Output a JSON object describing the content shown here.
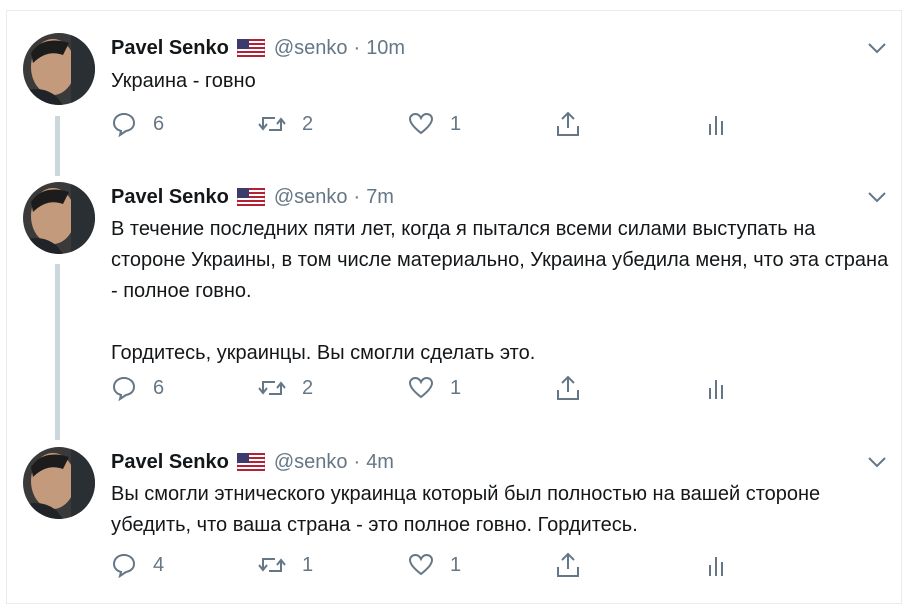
{
  "colors": {
    "text": "#14171a",
    "muted": "#657786",
    "thread_line": "#ccd6dd",
    "divider": "#e6ecf0"
  },
  "tweets": [
    {
      "author": "Pavel Senko",
      "flag_icon": "us-flag-icon",
      "handle": "@senko",
      "separator": "·",
      "time": "10m",
      "paragraphs": [
        "Украина - говно"
      ],
      "replies": "6",
      "retweets": "2",
      "likes": "1"
    },
    {
      "author": "Pavel Senko",
      "flag_icon": "us-flag-icon",
      "handle": "@senko",
      "separator": "·",
      "time": "7m",
      "paragraphs": [
        "В течение последних пяти лет, когда я пытался всеми силами выступать на стороне Украины, в том числе материально, Украина убедила меня, что эта страна - полное говно.",
        "Гордитесь, украинцы. Вы смогли сделать это."
      ],
      "replies": "6",
      "retweets": "2",
      "likes": "1"
    },
    {
      "author": "Pavel Senko",
      "flag_icon": "us-flag-icon",
      "handle": "@senko",
      "separator": "·",
      "time": "4m",
      "paragraphs": [
        "Вы смогли этнического украинца который был полностью на вашей стороне убедить, что ваша страна - это полное говно. Гордитесь."
      ],
      "replies": "4",
      "retweets": "1",
      "likes": "1"
    }
  ]
}
